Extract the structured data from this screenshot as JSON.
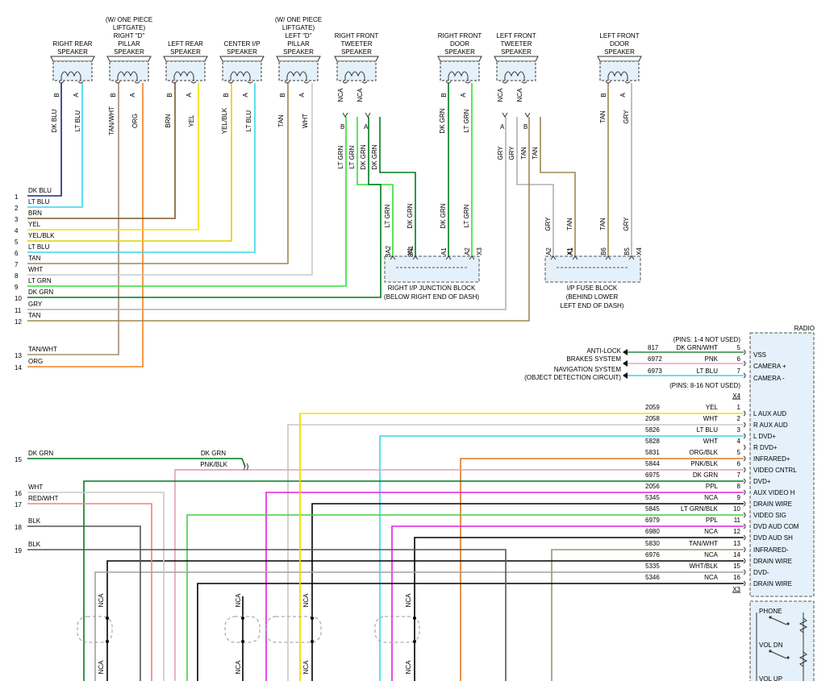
{
  "speakers": [
    {
      "title": [
        "RIGHT REAR",
        "SPEAKER"
      ],
      "pins": [
        "B",
        "A"
      ],
      "wires": [
        "DK BLU",
        "LT BLU"
      ],
      "colors": [
        "#1a237e",
        "#34d8f0"
      ]
    },
    {
      "title": [
        "(W/ ONE PIECE",
        "LIFTGATE)",
        "RIGHT \"D\"",
        "PILLAR",
        "SPEAKER"
      ],
      "pins": [
        "B",
        "A"
      ],
      "wires": [
        "TAN/WHT",
        "ORG"
      ],
      "colors": [
        "#a09070",
        "#f08020"
      ]
    },
    {
      "title": [
        "LEFT REAR",
        "SPEAKER"
      ],
      "pins": [
        "B",
        "A"
      ],
      "wires": [
        "BRN",
        "YEL"
      ],
      "colors": [
        "#7a5a2a",
        "#f0e000"
      ]
    },
    {
      "title": [
        "CENTER I/P",
        "SPEAKER"
      ],
      "pins": [
        "B",
        "A"
      ],
      "wires": [
        "YEL/BLK",
        "LT BLU"
      ],
      "colors": [
        "#e0d000",
        "#34d8f0"
      ]
    },
    {
      "title": [
        "(W/ ONE PIECE",
        "LIFTGATE)",
        "LEFT \"D\"",
        "PILLAR",
        "SPEAKER"
      ],
      "pins": [
        "B",
        "A"
      ],
      "wires": [
        "TAN",
        "WHT"
      ],
      "colors": [
        "#a08850",
        "#c8c8c8"
      ]
    },
    {
      "title": [
        "RIGHT FRONT",
        "TWEETER",
        "SPEAKER"
      ],
      "pins": [
        "NCA",
        "NCA"
      ],
      "wires": [],
      "colors": []
    },
    {
      "title": [
        "RIGHT FRONT",
        "DOOR",
        "SPEAKER"
      ],
      "pins": [
        "B",
        "A"
      ],
      "wires": [
        "DK GRN",
        "LT GRN"
      ],
      "colors": [
        "#007a20",
        "#30e030"
      ]
    },
    {
      "title": [
        "LEFT FRONT",
        "TWEETER",
        "SPEAKER"
      ],
      "pins": [
        "NCA",
        "NCA"
      ],
      "wires": [],
      "colors": []
    },
    {
      "title": [
        "LEFT FRONT",
        "DOOR",
        "SPEAKER"
      ],
      "pins": [
        "B",
        "A"
      ],
      "wires": [
        "TAN",
        "GRY"
      ],
      "colors": [
        "#a08850",
        "#b0b0b0"
      ]
    }
  ],
  "tweeter_wires": {
    "right": [
      "B",
      "A",
      "LT GRN",
      "LT GRN",
      "DK GRN",
      "DK GRN"
    ],
    "left": [
      "A",
      "B",
      "GRY",
      "GRY",
      "TAN",
      "TAN"
    ]
  },
  "left_bus": [
    {
      "num": "1",
      "label": "DK BLU"
    },
    {
      "num": "2",
      "label": "LT BLU"
    },
    {
      "num": "3",
      "label": "BRN"
    },
    {
      "num": "4",
      "label": "YEL"
    },
    {
      "num": "5",
      "label": "YEL/BLK"
    },
    {
      "num": "6",
      "label": "LT BLU"
    },
    {
      "num": "7",
      "label": "TAN"
    },
    {
      "num": "8",
      "label": "WHT"
    },
    {
      "num": "9",
      "label": "LT GRN"
    },
    {
      "num": "10",
      "label": "DK GRN"
    },
    {
      "num": "11",
      "label": "GRY"
    },
    {
      "num": "12",
      "label": "TAN"
    },
    {
      "num": "13",
      "label": "TAN/WHT"
    },
    {
      "num": "14",
      "label": "ORG"
    }
  ],
  "junction_right": {
    "wires": [
      "LT GRN",
      "DK GRN",
      "DK GRN",
      "LT GRN"
    ],
    "pins": [
      "3A2",
      "3A1",
      "A1",
      "A2",
      "X3"
    ],
    "pin_x1": "X1",
    "label": [
      "RIGHT I/P JUNCTION BLOCK",
      "(BELOW RIGHT END OF DASH)"
    ]
  },
  "junction_left": {
    "wires": [
      "GRY",
      "TAN",
      "TAN",
      "GRY"
    ],
    "pins": [
      "A2",
      "A1",
      "B6",
      "B5",
      "X4"
    ],
    "pin_x1": "X1",
    "label": [
      "I/P FUSE BLOCK",
      "(BEHIND LOWER",
      "LEFT END OF DASH)"
    ]
  },
  "radio": {
    "title": "RADIO",
    "x4_note_top": "(PINS: 1-4 NOT USED)",
    "x4_note_bottom": "(PINS: 8-16 NOT USED)",
    "x4_tag": "X4",
    "x3_tag": "X3",
    "x4_rows": [
      {
        "circuit": "817",
        "color": "DK GRN/WHT",
        "pin": "5",
        "func": "VSS"
      },
      {
        "circuit": "6972",
        "color": "PNK",
        "pin": "6",
        "func": "CAMERA +"
      },
      {
        "circuit": "6973",
        "color": "LT BLU",
        "pin": "7",
        "func": "CAMERA -"
      }
    ],
    "x4_dest": [
      "ANTI-LOCK",
      "BRAKES SYSTEM",
      "NAVIGATION SYSTEM",
      "(OBJECT DETECTION CIRCUIT)"
    ],
    "x3_rows": [
      {
        "circuit": "2059",
        "color": "YEL",
        "pin": "1",
        "func": "L AUX AUD"
      },
      {
        "circuit": "2058",
        "color": "WHT",
        "pin": "2",
        "func": "R AUX AUD"
      },
      {
        "circuit": "5826",
        "color": "LT BLU",
        "pin": "3",
        "func": "L DVD+"
      },
      {
        "circuit": "5828",
        "color": "WHT",
        "pin": "4",
        "func": "R DVD+"
      },
      {
        "circuit": "5831",
        "color": "ORG/BLK",
        "pin": "5",
        "func": "INFRARED+"
      },
      {
        "circuit": "5844",
        "color": "PNK/BLK",
        "pin": "6",
        "func": "VIDEO CNTRL"
      },
      {
        "circuit": "6975",
        "color": "DK GRN",
        "pin": "7",
        "func": "DVD+"
      },
      {
        "circuit": "2056",
        "color": "PPL",
        "pin": "8",
        "func": "AUX VIDEO H"
      },
      {
        "circuit": "5345",
        "color": "NCA",
        "pin": "9",
        "func": "DRAIN WIRE"
      },
      {
        "circuit": "5845",
        "color": "LT GRN/BLK",
        "pin": "10",
        "func": "VIDEO SIG"
      },
      {
        "circuit": "6979",
        "color": "PPL",
        "pin": "11",
        "func": "DVD AUD COM"
      },
      {
        "circuit": "6980",
        "color": "NCA",
        "pin": "12",
        "func": "DVD AUD SH"
      },
      {
        "circuit": "5830",
        "color": "TAN/WHT",
        "pin": "13",
        "func": "INFRARED-"
      },
      {
        "circuit": "6976",
        "color": "NCA",
        "pin": "14",
        "func": "DRAIN WIRE"
      },
      {
        "circuit": "5335",
        "color": "WHT/BLK",
        "pin": "15",
        "func": "DVD-"
      },
      {
        "circuit": "5346",
        "color": "NCA",
        "pin": "16",
        "func": "DRAIN WIRE"
      }
    ],
    "switches": [
      "PHONE",
      "VOL DN",
      "VOL UP"
    ]
  },
  "lower_left": [
    {
      "num": "15",
      "label": "DK GRN",
      "label2": "DK GRN"
    },
    {
      "num": "16",
      "label": "WHT"
    },
    {
      "num": "17",
      "label": "RED/WHT"
    },
    {
      "num": "18",
      "label": "BLK"
    },
    {
      "num": "19",
      "label": "BLK"
    }
  ],
  "splice_label": "PNK/BLK",
  "nca": "NCA"
}
